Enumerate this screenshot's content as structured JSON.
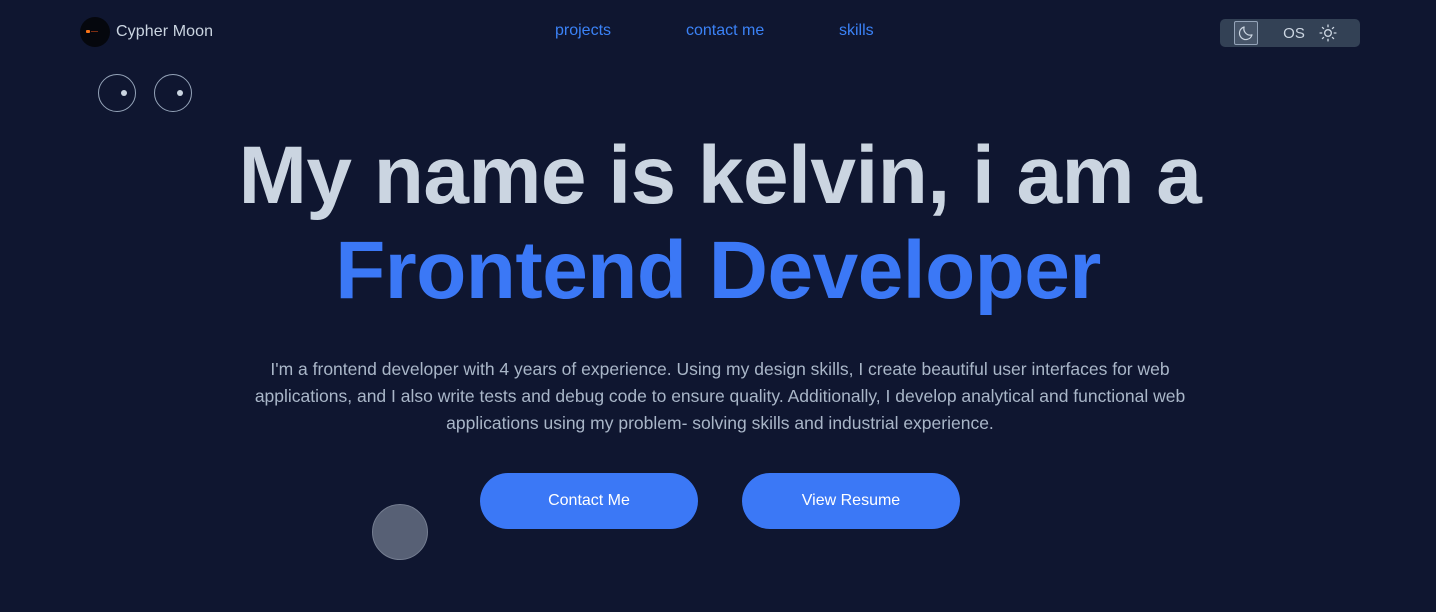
{
  "header": {
    "brand_name": "Cypher Moon",
    "nav": [
      {
        "label": "projects"
      },
      {
        "label": "contact me"
      },
      {
        "label": "skills"
      }
    ],
    "theme_switch": {
      "options": [
        "dark",
        "OS",
        "light"
      ],
      "os_label": "OS",
      "selected": "dark"
    }
  },
  "hero": {
    "title_line1": "My name is kelvin, i am a",
    "title_line2": "Frontend Developer",
    "description": "I'm a frontend developer with 4 years of experience. Using my design skills, I create beautiful user interfaces for web applications, and I also write tests and debug code to ensure quality. Additionally, I develop analytical and functional web applications using my problem- solving skills and industrial experience.",
    "buttons": {
      "contact": "Contact Me",
      "resume": "View Resume"
    }
  },
  "colors": {
    "background": "#0f1630",
    "accent": "#3b78f6",
    "text": "#cbd5e1",
    "muted": "#a9b6c8"
  },
  "icons": [
    "logo-icon",
    "moon-icon",
    "sun-icon"
  ]
}
